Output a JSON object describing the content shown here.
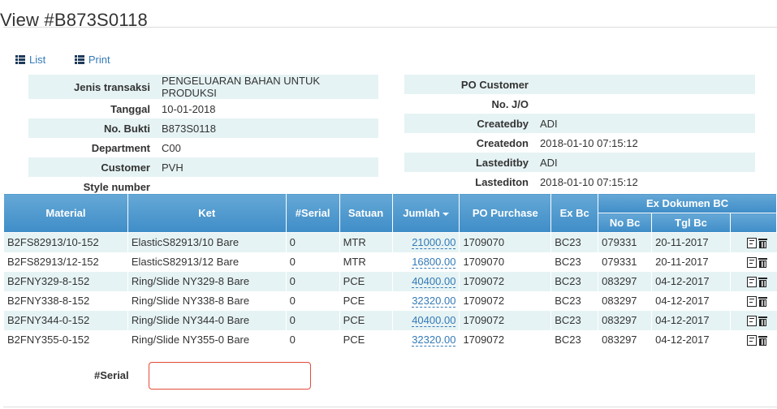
{
  "page": {
    "title": "View #B873S0118"
  },
  "actions": {
    "list_label": "List",
    "print_label": "Print"
  },
  "info_left": [
    {
      "label": "Jenis transaksi",
      "value": "PENGELUARAN BAHAN UNTUK PRODUKSI"
    },
    {
      "label": "Tanggal",
      "value": "10-01-2018"
    },
    {
      "label": "No. Bukti",
      "value": "B873S0118"
    },
    {
      "label": "Department",
      "value": "C00"
    },
    {
      "label": "Customer",
      "value": "PVH"
    },
    {
      "label": "Style number",
      "value": ""
    }
  ],
  "info_right": [
    {
      "label": "PO Customer",
      "value": ""
    },
    {
      "label": "No. J/O",
      "value": ""
    },
    {
      "label": "Createdby",
      "value": "ADI"
    },
    {
      "label": "Createdon",
      "value": "2018-01-10 07:15:12"
    },
    {
      "label": "Lasteditby",
      "value": "ADI"
    },
    {
      "label": "Lastediton",
      "value": "2018-01-10 07:15:12"
    }
  ],
  "grid": {
    "headers": {
      "material": "Material",
      "ket": "Ket",
      "serial": "#Serial",
      "satuan": "Satuan",
      "jumlah": "Jumlah",
      "po_purchase": "PO Purchase",
      "ex_bc": "Ex Bc",
      "ex_dokumen_bc": "Ex Dokumen BC",
      "no_bc": "No Bc",
      "tgl_bc": "Tgl Bc"
    },
    "rows": [
      {
        "material": "B2FS82913/10-152",
        "ket": "ElasticS82913/10 Bare",
        "serial": "0",
        "satuan": "MTR",
        "jumlah": "21000.00",
        "po_purchase": "1709070",
        "ex_bc": "BC23",
        "no_bc": "079331",
        "tgl_bc": "20-11-2017"
      },
      {
        "material": "B2FS82913/12-152",
        "ket": "ElasticS82913/12 Bare",
        "serial": "0",
        "satuan": "MTR",
        "jumlah": "16800.00",
        "po_purchase": "1709070",
        "ex_bc": "BC23",
        "no_bc": "079331",
        "tgl_bc": "20-11-2017"
      },
      {
        "material": "B2FNY329-8-152",
        "ket": "Ring/Slide NY329-8 Bare",
        "serial": "0",
        "satuan": "PCE",
        "jumlah": "40400.00",
        "po_purchase": "1709072",
        "ex_bc": "BC23",
        "no_bc": "083297",
        "tgl_bc": "04-12-2017"
      },
      {
        "material": "B2FNY338-8-152",
        "ket": "Ring/Slide NY338-8 Bare",
        "serial": "0",
        "satuan": "PCE",
        "jumlah": "32320.00",
        "po_purchase": "1709072",
        "ex_bc": "BC23",
        "no_bc": "083297",
        "tgl_bc": "04-12-2017"
      },
      {
        "material": "B2FNY344-0-152",
        "ket": "Ring/Slide NY344-0 Bare",
        "serial": "0",
        "satuan": "PCE",
        "jumlah": "40400.00",
        "po_purchase": "1709072",
        "ex_bc": "BC23",
        "no_bc": "083297",
        "tgl_bc": "04-12-2017"
      },
      {
        "material": "B2FNY355-0-152",
        "ket": "Ring/Slide NY355-0 Bare",
        "serial": "0",
        "satuan": "PCE",
        "jumlah": "32320.00",
        "po_purchase": "1709072",
        "ex_bc": "BC23",
        "no_bc": "083297",
        "tgl_bc": "04-12-2017"
      }
    ]
  },
  "serial_form": {
    "label": "#Serial",
    "value": "",
    "placeholder": ""
  },
  "icons": {
    "list": "list-icon",
    "print": "list-icon",
    "edit": "edit-icon",
    "delete": "trash-icon"
  },
  "colors": {
    "header_blue": "#4a97cf",
    "stripe": "#e6f3f4",
    "link": "#337ab7",
    "error_border": "#e74c3c"
  }
}
